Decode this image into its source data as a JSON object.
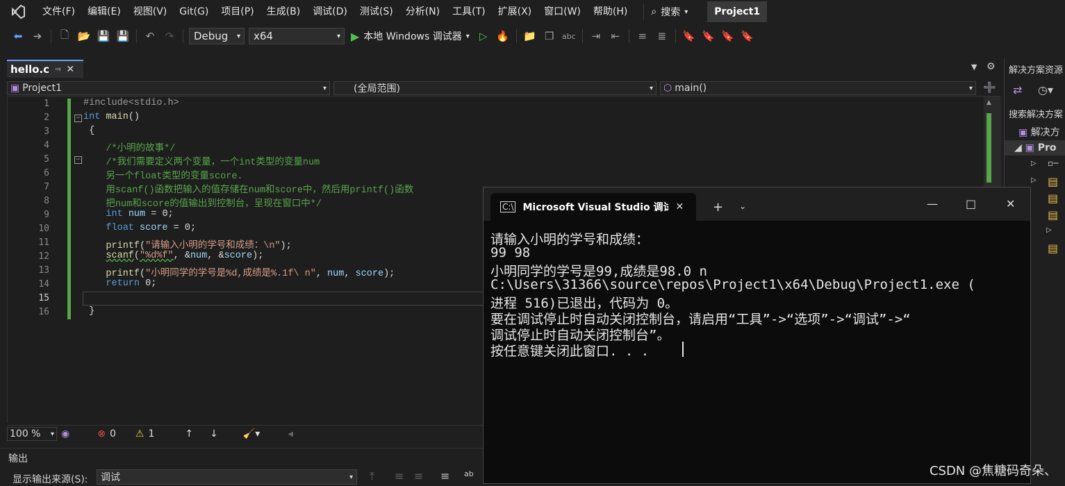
{
  "menu": {
    "items": [
      "文件(F)",
      "编辑(E)",
      "视图(V)",
      "Git(G)",
      "项目(P)",
      "生成(B)",
      "调试(D)",
      "测试(S)",
      "分析(N)",
      "工具(T)",
      "扩展(X)",
      "窗口(W)",
      "帮助(H)"
    ],
    "search_label": "搜索",
    "project_badge": "Project1"
  },
  "toolbar": {
    "config": "Debug",
    "platform": "x64",
    "run_label": "本地 Windows 调试器"
  },
  "tab": {
    "label": "hello.c"
  },
  "navbar": {
    "project": "Project1",
    "scope": "(全局范围)",
    "member": "main()"
  },
  "editor": {
    "line_numbers": [
      "1",
      "2",
      "3",
      "4",
      "5",
      "6",
      "7",
      "8",
      "9",
      "10",
      "11",
      "12",
      "13",
      "14",
      "15",
      "16"
    ]
  },
  "status": {
    "zoom": "100 %",
    "errors": "0",
    "warnings": "1"
  },
  "output": {
    "title": "输出",
    "source_label": "显示输出来源(S):",
    "source_value": "调试"
  },
  "solution": {
    "title": "解决方案资源",
    "search": "搜索解决方案",
    "root": "解决方",
    "project": "Pro"
  },
  "console": {
    "title": "Microsoft Visual Studio 调试控制台",
    "lines": [
      "请输入小明的学号和成绩：",
      "99 98",
      "小明同学的学号是99,成绩是98.0 n",
      "C:\\Users\\31366\\source\\repos\\Project1\\x64\\Debug\\Project1.exe (",
      "进程 516)已退出，代码为 0。",
      "要在调试停止时自动关闭控制台，请启用“工具”->“选项”->“调试”->“",
      "调试停止时自动关闭控制台”。",
      "按任意键关闭此窗口. . ."
    ]
  },
  "watermark": "CSDN @焦糖码奇朵、",
  "colors": {
    "accent": "#57a64a",
    "keyword": "#569cd6",
    "comment": "#57a64a",
    "string": "#d69d85"
  }
}
